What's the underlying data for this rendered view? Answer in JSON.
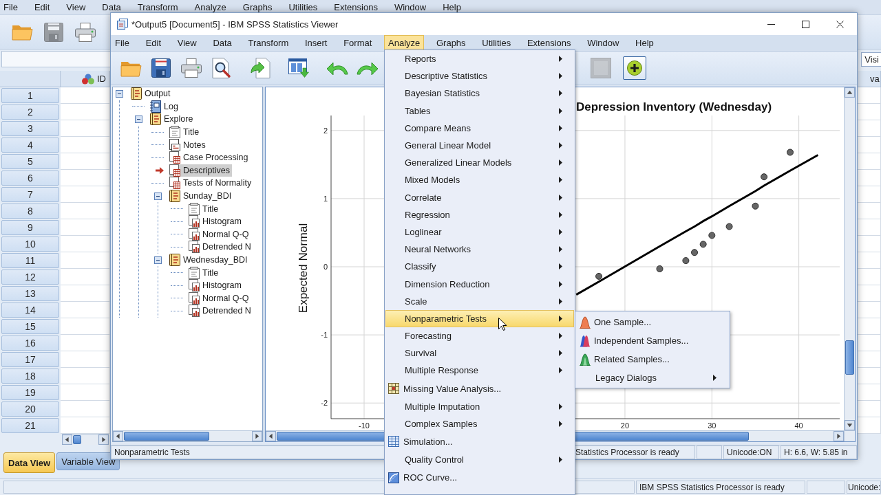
{
  "data_editor": {
    "menu": [
      "File",
      "Edit",
      "View",
      "Data",
      "Transform",
      "Analyze",
      "Graphs",
      "Utilities",
      "Extensions",
      "Window",
      "Help"
    ],
    "toolbar": [
      {
        "kind": "open",
        "disabled": false
      },
      {
        "kind": "save",
        "disabled": true
      },
      {
        "kind": "print",
        "disabled": false
      }
    ],
    "info_label": "Visi",
    "columns": [
      {
        "label": "ID",
        "kind": "nominal"
      },
      {
        "label": "va",
        "kind": "plain"
      }
    ],
    "rows": [
      "1",
      "2",
      "3",
      "4",
      "5",
      "6",
      "7",
      "8",
      "9",
      "10",
      "11",
      "12",
      "13",
      "14",
      "15",
      "16",
      "17",
      "18",
      "19",
      "20",
      "21"
    ],
    "tabs": [
      {
        "label": "Data View",
        "selected": true
      },
      {
        "label": "Variable View",
        "selected": false
      }
    ],
    "status_bar": [
      "IBM SPSS Statistics Processor is ready",
      "Unicode:"
    ]
  },
  "output_window": {
    "title": "*Output5 [Document5] - IBM SPSS Statistics Viewer",
    "menu": [
      {
        "label": "File",
        "selected": false
      },
      {
        "label": "Edit",
        "selected": false
      },
      {
        "label": "View",
        "selected": false
      },
      {
        "label": "Data",
        "selected": false
      },
      {
        "label": "Transform",
        "selected": false
      },
      {
        "label": "Insert",
        "selected": false
      },
      {
        "label": "Format",
        "selected": false
      },
      {
        "label": "Analyze",
        "selected": true
      },
      {
        "label": "Graphs",
        "selected": false
      },
      {
        "label": "Utilities",
        "selected": false
      },
      {
        "label": "Extensions",
        "selected": false
      },
      {
        "label": "Window",
        "selected": false
      },
      {
        "label": "Help",
        "selected": false
      }
    ],
    "toolbar": [
      {
        "items": [
          {
            "kind": "open",
            "disabled": false,
            "pressed": false
          },
          {
            "kind": "save",
            "disabled": false,
            "pressed": false
          },
          {
            "kind": "print",
            "disabled": false,
            "pressed": false
          },
          {
            "kind": "preview",
            "disabled": false,
            "pressed": false
          }
        ]
      },
      {
        "items": [
          {
            "kind": "export",
            "disabled": false,
            "pressed": false
          }
        ]
      },
      {
        "items": [
          {
            "kind": "designate",
            "disabled": false,
            "pressed": false
          }
        ]
      },
      {
        "items": [
          {
            "kind": "undo",
            "disabled": false,
            "pressed": false
          },
          {
            "kind": "redo",
            "disabled": false,
            "pressed": false
          }
        ]
      },
      {
        "items": [
          {
            "kind": "blank",
            "disabled": true,
            "pressed": false
          },
          {
            "kind": "insert",
            "disabled": false,
            "pressed": true
          }
        ]
      }
    ],
    "tree": [
      {
        "label": "Output",
        "kind": "book",
        "selected": false,
        "expanded": true,
        "children": [
          {
            "label": "Log",
            "kind": "log",
            "selected": false
          },
          {
            "label": "Explore",
            "kind": "book",
            "selected": false,
            "expanded": true,
            "children": [
              {
                "label": "Title",
                "kind": "title",
                "selected": false
              },
              {
                "label": "Notes",
                "kind": "notes",
                "selected": false
              },
              {
                "label": "Case Processing",
                "kind": "table",
                "selected": false
              },
              {
                "label": "Descriptives",
                "kind": "table",
                "selected": true
              },
              {
                "label": "Tests of Normality",
                "kind": "table",
                "selected": false
              },
              {
                "label": "Sunday_BDI",
                "kind": "book",
                "selected": false,
                "expanded": true,
                "children": [
                  {
                    "label": "Title",
                    "kind": "title",
                    "selected": false
                  },
                  {
                    "label": "Histogram",
                    "kind": "chart",
                    "selected": false
                  },
                  {
                    "label": "Normal Q-Q",
                    "kind": "chart",
                    "selected": false
                  },
                  {
                    "label": "Detrended N",
                    "kind": "chart",
                    "selected": false
                  }
                ]
              },
              {
                "label": "Wednesday_BDI",
                "kind": "book",
                "selected": false,
                "expanded": true,
                "children": [
                  {
                    "label": "Title",
                    "kind": "title",
                    "selected": false
                  },
                  {
                    "label": "Histogram",
                    "kind": "chart",
                    "selected": false
                  },
                  {
                    "label": "Normal Q-Q",
                    "kind": "chart",
                    "selected": false
                  },
                  {
                    "label": "Detrended N",
                    "kind": "chart",
                    "selected": false
                  }
                ]
              }
            ]
          }
        ]
      }
    ],
    "chart": {
      "chart_data": {
        "type": "scatter",
        "title": "Depression Inventory (Wednesday)",
        "ylabel": "Expected Normal",
        "x": [
          14.4,
          17,
          24,
          27,
          28,
          29,
          30,
          32,
          35,
          36,
          39,
          42.2
        ],
        "series": [
          {
            "values": [
              null,
              -0.14,
              -0.03,
              0.09,
              0.21,
              0.33,
              0.46,
              0.59,
              0.89,
              1.32,
              1.68,
              null
            ]
          },
          {
            "type": "line",
            "values": [
              -0.41,
              -0.22,
              0.3,
              0.52,
              0.59,
              0.67,
              0.74,
              0.89,
              1.11,
              1.19,
              1.41,
              1.64
            ]
          }
        ],
        "xlim": [
          -13.8,
          44.7
        ],
        "ylim": [
          -2.23,
          2.22
        ],
        "xticks": [
          -10,
          20,
          30,
          40
        ],
        "yticks": [
          -2,
          -1,
          0,
          1,
          2
        ],
        "grid": true
      }
    },
    "status_bar": [
      "Nonparametric Tests",
      "Statistics Processor is ready",
      "Unicode:ON",
      "H: 6.6, W: 5.85 in"
    ]
  },
  "analyze_menu": [
    {
      "label": "Reports",
      "kind": "submenu",
      "selected": false
    },
    {
      "label": "Descriptive Statistics",
      "kind": "submenu",
      "selected": false
    },
    {
      "label": "Bayesian Statistics",
      "kind": "submenu",
      "selected": false
    },
    {
      "label": "Tables",
      "kind": "submenu",
      "selected": false
    },
    {
      "label": "Compare Means",
      "kind": "submenu",
      "selected": false
    },
    {
      "label": "General Linear Model",
      "kind": "submenu",
      "selected": false
    },
    {
      "label": "Generalized Linear Models",
      "kind": "submenu",
      "selected": false
    },
    {
      "label": "Mixed Models",
      "kind": "submenu",
      "selected": false
    },
    {
      "label": "Correlate",
      "kind": "submenu",
      "selected": false
    },
    {
      "label": "Regression",
      "kind": "submenu",
      "selected": false
    },
    {
      "label": "Loglinear",
      "kind": "submenu",
      "selected": false
    },
    {
      "label": "Neural Networks",
      "kind": "submenu",
      "selected": false
    },
    {
      "label": "Classify",
      "kind": "submenu",
      "selected": false
    },
    {
      "label": "Dimension Reduction",
      "kind": "submenu",
      "selected": false
    },
    {
      "label": "Scale",
      "kind": "submenu",
      "selected": false
    },
    {
      "label": "Nonparametric Tests",
      "kind": "submenu",
      "selected": true
    },
    {
      "label": "Forecasting",
      "kind": "submenu",
      "selected": false
    },
    {
      "label": "Survival",
      "kind": "submenu",
      "selected": false
    },
    {
      "label": "Multiple Response",
      "kind": "submenu",
      "selected": false
    },
    {
      "label": "Missing Value Analysis...",
      "kind": "missing_values",
      "selected": false
    },
    {
      "label": "Multiple Imputation",
      "kind": "submenu",
      "selected": false
    },
    {
      "label": "Complex Samples",
      "kind": "submenu",
      "selected": false
    },
    {
      "label": "Simulation...",
      "kind": "simulation",
      "selected": false
    },
    {
      "label": "Quality Control",
      "kind": "submenu",
      "selected": false
    },
    {
      "label": "ROC Curve...",
      "kind": "roc",
      "selected": false
    }
  ],
  "nonparametric_submenu": [
    {
      "label": "One Sample...",
      "kind": "one_sample",
      "selected": false
    },
    {
      "label": "Independent Samples...",
      "kind": "independent",
      "selected": false
    },
    {
      "label": "Related Samples...",
      "kind": "related",
      "selected": false
    },
    {
      "label": "Legacy Dialogs",
      "kind": "submenu",
      "selected": false
    }
  ]
}
